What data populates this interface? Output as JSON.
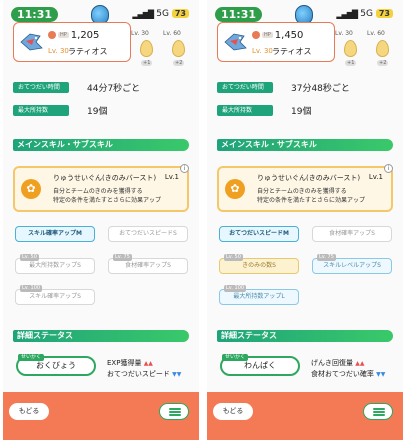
{
  "panels": [
    {
      "status": {
        "time": "11:31",
        "network": "5G",
        "battery": "73"
      },
      "pokemon": {
        "hp_pill": "HP",
        "hp": "1,205",
        "level": "Lv. 30",
        "name": "ラティオス"
      },
      "eggs": [
        {
          "lv": "Lv. 30",
          "tick": "+1"
        },
        {
          "lv": "Lv. 60",
          "tick": "+2"
        }
      ],
      "help_interval": {
        "label": "おてつだい時間",
        "value": "44分7秒ごと"
      },
      "max_carry": {
        "label": "最大所持数",
        "value": "19個"
      },
      "main_skill_header": "メインスキル・サブスキル",
      "main_skill": {
        "name": "りゅうせいぐん(きのみバースト)",
        "level": "Lv.1",
        "desc1": "自分とチームのきのみを獲得する",
        "desc2": "特定の条件を満たすとさらに効果アップ"
      },
      "subskills": [
        {
          "label": "スキル確率アップM",
          "tag": ""
        },
        {
          "label": "おてつだいスピードS",
          "tag": ""
        },
        {
          "label": "最大所持数アップS",
          "tag": "Lv. 50"
        },
        {
          "label": "食材確率アップS",
          "tag": "Lv. 75"
        },
        {
          "label": "スキル確率アップS",
          "tag": "Lv. 100"
        }
      ],
      "detail_header": "詳細ステータス",
      "nature": {
        "tag": "せいかく",
        "name": "おくびょう",
        "effects": [
          {
            "label": "EXP獲得量",
            "mark": "▲▲"
          },
          {
            "label": "おてつだいスピード",
            "mark": "▼▼"
          }
        ]
      },
      "footer": {
        "back": "もどる"
      }
    },
    {
      "status": {
        "time": "11:31",
        "network": "5G",
        "battery": "73"
      },
      "pokemon": {
        "hp_pill": "HP",
        "hp": "1,450",
        "level": "Lv. 30",
        "name": "ラティオス"
      },
      "eggs": [
        {
          "lv": "Lv. 30",
          "tick": "+1"
        },
        {
          "lv": "Lv. 60",
          "tick": "+2"
        }
      ],
      "help_interval": {
        "label": "おてつだい時間",
        "value": "37分48秒ごと"
      },
      "max_carry": {
        "label": "最大所持数",
        "value": "19個"
      },
      "main_skill_header": "メインスキル・サブスキル",
      "main_skill": {
        "name": "りゅうせいぐん(きのみバースト)",
        "level": "Lv.1",
        "desc1": "自分とチームのきのみを獲得する",
        "desc2": "特定の条件を満たすとさらに効果アップ"
      },
      "subskills": [
        {
          "label": "おてつだいスピードM",
          "tag": ""
        },
        {
          "label": "食材確率アップS",
          "tag": ""
        },
        {
          "label": "きのみの数S",
          "tag": "Lv. 50"
        },
        {
          "label": "スキルレベルアップS",
          "tag": "Lv. 75"
        },
        {
          "label": "最大所持数アップL",
          "tag": "Lv. 100"
        }
      ],
      "detail_header": "詳細ステータス",
      "nature": {
        "tag": "せいかく",
        "name": "わんぱく",
        "effects": [
          {
            "label": "げんき回復量",
            "mark": "▲▲"
          },
          {
            "label": "食材おてつだい確率",
            "mark": "▼▼"
          }
        ]
      },
      "footer": {
        "back": "もどる"
      }
    }
  ]
}
